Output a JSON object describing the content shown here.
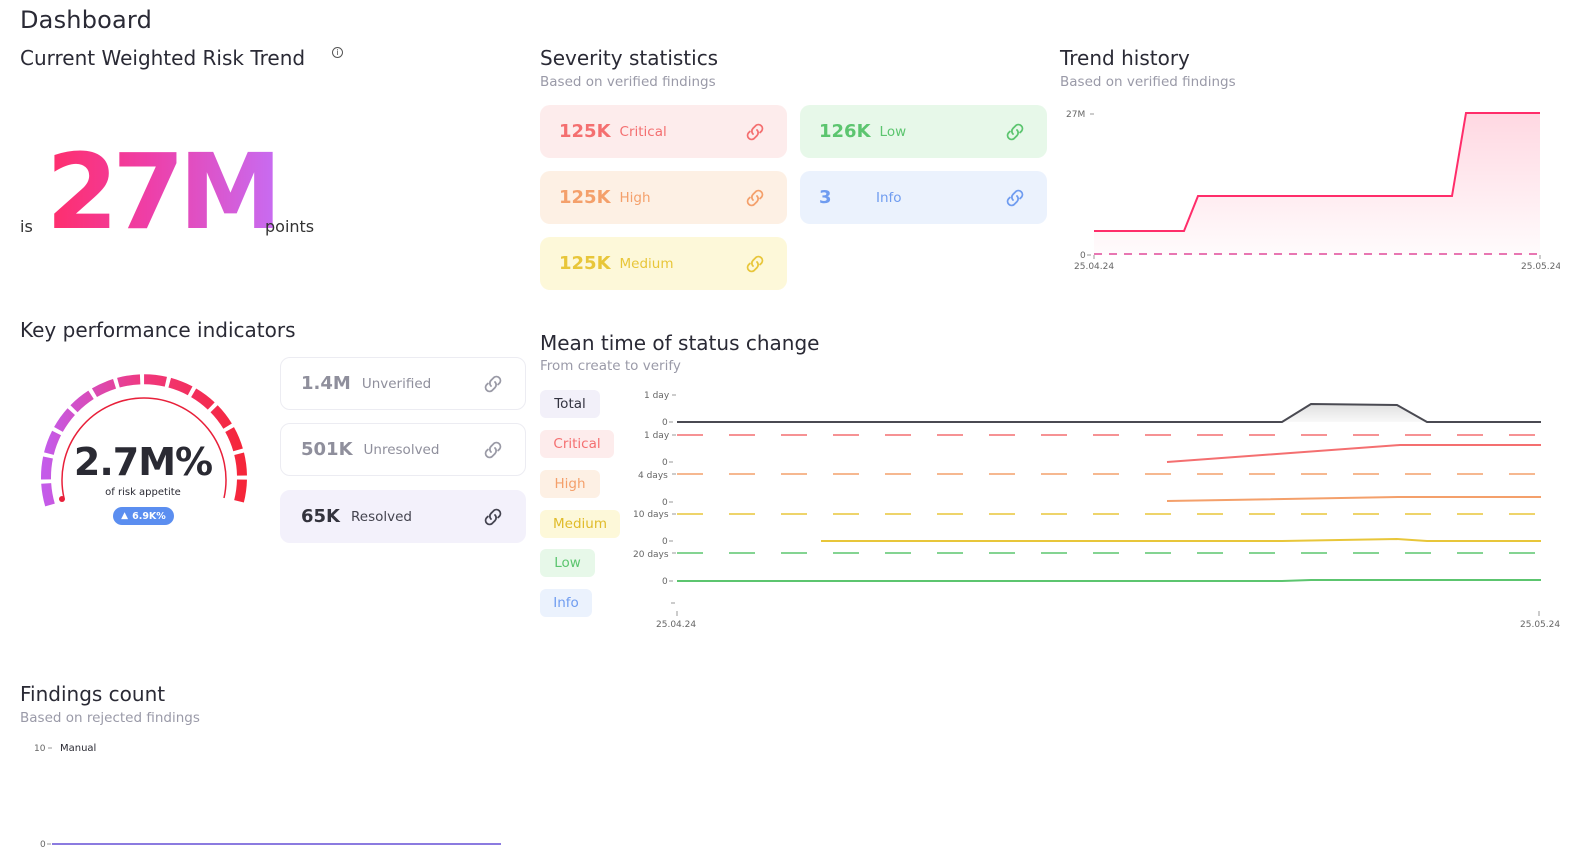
{
  "page_title": "Dashboard",
  "risk_trend": {
    "title": "Current Weighted Risk Trend",
    "prefix": "is",
    "value": "27M",
    "suffix": "points"
  },
  "severity": {
    "title": "Severity statistics",
    "subtitle": "Based on verified findings",
    "cards": [
      {
        "value": "125K",
        "label": "Critical",
        "color": "#f46f70",
        "bg": "#fdecec"
      },
      {
        "value": "126K",
        "label": "Low",
        "color": "#5cc56f",
        "bg": "#e7f8e9"
      },
      {
        "value": "125K",
        "label": "High",
        "color": "#f4a06b",
        "bg": "#fdf0e4"
      },
      {
        "value": "3",
        "label": "Info",
        "color": "#6f9cf0",
        "bg": "#ebf2fd"
      },
      {
        "value": "125K",
        "label": "Medium",
        "color": "#e8c63a",
        "bg": "#fdf8d9"
      }
    ]
  },
  "trend_history": {
    "title": "Trend history",
    "subtitle": "Based on verified findings",
    "y_top": "27M",
    "y_bottom": "0",
    "x_start": "25.04.24",
    "x_end": "25.05.24"
  },
  "kpi": {
    "title": "Key performance indicators",
    "gauge_value": "2.7M%",
    "gauge_caption": "of risk appetite",
    "gauge_badge": "6.9K%",
    "cards": [
      {
        "value": "1.4M",
        "label": "Unverified"
      },
      {
        "value": "501K",
        "label": "Unresolved"
      },
      {
        "value": "65K",
        "label": "Resolved"
      }
    ]
  },
  "mean_time": {
    "title": "Mean time of status change",
    "subtitle": "From create to verify",
    "rows": [
      {
        "label": "Total",
        "color": "#4a4a52",
        "pill_bg": "#f2f0f9",
        "pill_fg": "#333340",
        "top_tick": "1 day"
      },
      {
        "label": "Critical",
        "color": "#f46f70",
        "pill_bg": "#fdecec",
        "pill_fg": "#f46f70",
        "top_tick": "1 day"
      },
      {
        "label": "High",
        "color": "#f4a06b",
        "pill_bg": "#fdf0e4",
        "pill_fg": "#f4a06b",
        "top_tick": "4 days"
      },
      {
        "label": "Medium",
        "color": "#e8c63a",
        "pill_bg": "#fdf8d9",
        "pill_fg": "#e0bb2a",
        "top_tick": "10 days"
      },
      {
        "label": "Low",
        "color": "#5cc56f",
        "pill_bg": "#e7f8e9",
        "pill_fg": "#5cc56f",
        "top_tick": "20 days"
      },
      {
        "label": "Info",
        "color": "#6f9cf0",
        "pill_bg": "#ebf2fd",
        "pill_fg": "#6f9cf0",
        "top_tick": ""
      }
    ],
    "zero_tick": "0",
    "x_start": "25.04.24",
    "x_end": "25.05.24"
  },
  "findings": {
    "title": "Findings count",
    "subtitle": "Based on rejected findings",
    "y_top": "10",
    "y_bottom": "0",
    "series_label": "Manual",
    "series_color": "#8b7be0"
  }
}
